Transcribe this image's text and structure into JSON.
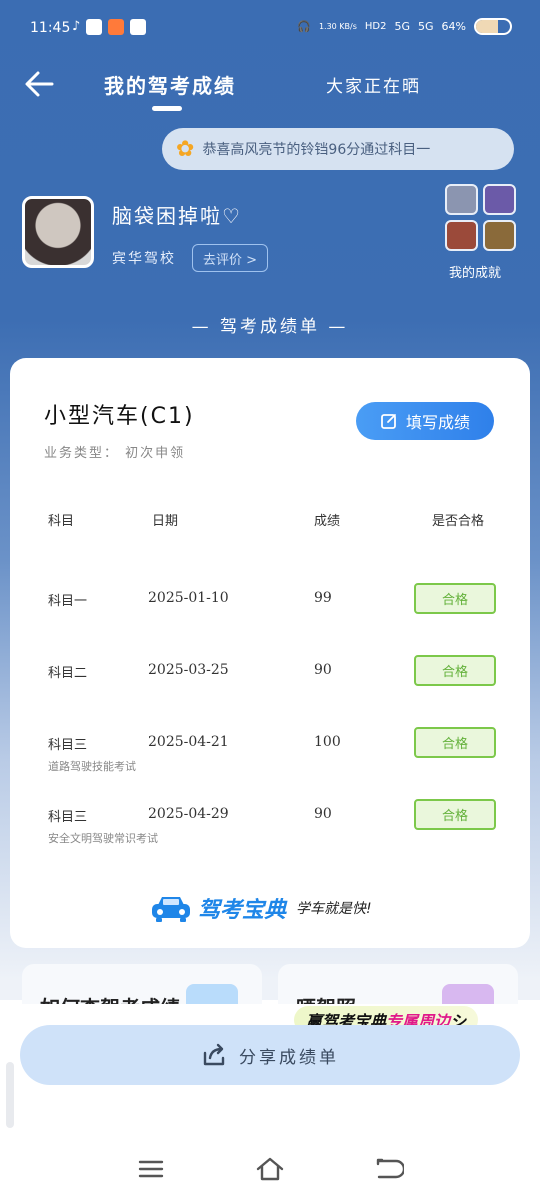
{
  "status_bar": {
    "time": "11:45",
    "network_speed": "1.30 KB/s",
    "hd": "HD2",
    "net1": "5G",
    "net2": "5G",
    "battery_label": "64%",
    "battery_level": 0.64
  },
  "nav": {
    "tab_active": "我的驾考成绩",
    "tab_other": "大家正在晒"
  },
  "congrats": {
    "icon": "flower-icon",
    "text": "恭喜高风亮节的铃铛96分通过科目一"
  },
  "profile": {
    "username": "脑袋困掉啦♡",
    "school": "宾华驾校",
    "review_label": "去评价 >",
    "achievements_label": "我的成就"
  },
  "section_title": "— 驾考成绩单 —",
  "card": {
    "license_type": "小型汽车(C1)",
    "business_type": "业务类型：  初次申领",
    "fill_button": "填写成绩",
    "headers": {
      "subject": "科目",
      "date": "日期",
      "score": "成绩",
      "result": "是否合格"
    },
    "rows": [
      {
        "subject": "科目一",
        "sub": "",
        "date": "2025-01-10",
        "score": "99",
        "result": "合格"
      },
      {
        "subject": "科目二",
        "sub": "",
        "date": "2025-03-25",
        "score": "90",
        "result": "合格"
      },
      {
        "subject": "科目三",
        "sub": "道路驾驶技能考试",
        "date": "2025-04-21",
        "score": "100",
        "result": "合格"
      },
      {
        "subject": "科目三",
        "sub": "安全文明驾驶常识考试",
        "date": "2025-04-29",
        "score": "90",
        "result": "合格"
      }
    ],
    "brand_name": "驾考宝典",
    "brand_slogan": "学车就是快!"
  },
  "bottom_cards": {
    "card1_title": "如何查驾考成绩",
    "card2_title": "晒驾照"
  },
  "promo": {
    "text_a": "赢驾考宝典",
    "text_b": "专属周边",
    "text_c": "シ"
  },
  "share_button": "分享成绩单",
  "colors": {
    "header_blue": "#3b6db3",
    "accent_blue": "#2f80ea",
    "pass_green": "#63b13a"
  }
}
